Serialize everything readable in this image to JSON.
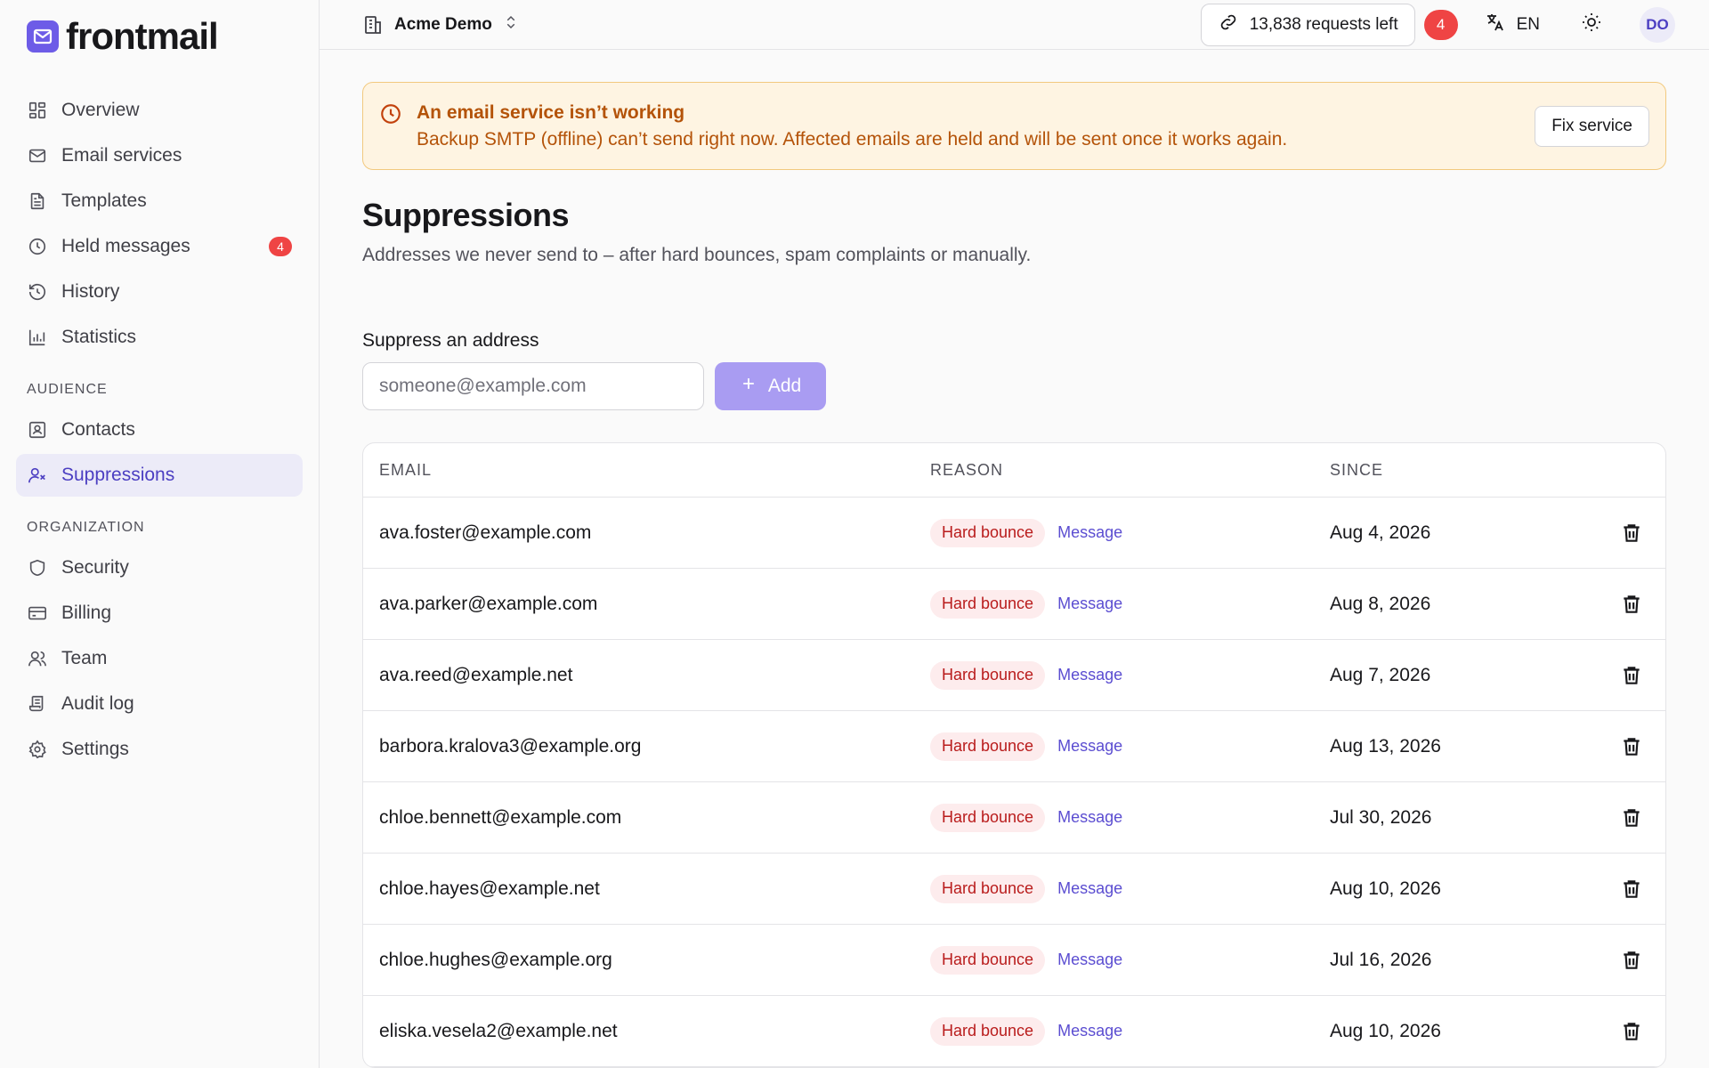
{
  "brand": {
    "name": "frontmail",
    "accent": "#6d5ce7"
  },
  "sidebar": {
    "items": [
      {
        "label": "Overview",
        "icon": "grid-icon"
      },
      {
        "label": "Email services",
        "icon": "mail-icon"
      },
      {
        "label": "Templates",
        "icon": "document-icon"
      },
      {
        "label": "Held messages",
        "icon": "clock-icon",
        "badge": "4"
      },
      {
        "label": "History",
        "icon": "history-icon"
      },
      {
        "label": "Statistics",
        "icon": "bar-chart-icon"
      }
    ],
    "audience_title": "AUDIENCE",
    "audience": [
      {
        "label": "Contacts",
        "icon": "contact-icon"
      },
      {
        "label": "Suppressions",
        "icon": "user-x-icon",
        "active": true
      }
    ],
    "organization_title": "ORGANIZATION",
    "organization": [
      {
        "label": "Security",
        "icon": "shield-icon"
      },
      {
        "label": "Billing",
        "icon": "credit-card-icon"
      },
      {
        "label": "Team",
        "icon": "users-icon"
      },
      {
        "label": "Audit log",
        "icon": "scroll-icon"
      },
      {
        "label": "Settings",
        "icon": "gear-icon"
      }
    ]
  },
  "topbar": {
    "org_name": "Acme Demo",
    "requests_left": "13,838 requests left",
    "notification_count": "4",
    "language": "EN",
    "avatar_initials": "DO"
  },
  "alert": {
    "title": "An email service isn’t working",
    "body": "Backup SMTP (offline) can’t send right now. Affected emails are held and will be sent once it works again.",
    "action": "Fix service",
    "color": "#b45309"
  },
  "page": {
    "title": "Suppressions",
    "subtitle": "Addresses we never send to – after hard bounces, spam complaints or manually."
  },
  "form": {
    "label": "Suppress an address",
    "placeholder": "someone@example.com",
    "add_label": "Add"
  },
  "table": {
    "headers": {
      "email": "EMAIL",
      "reason": "REASON",
      "since": "SINCE"
    },
    "rows": [
      {
        "email": "ava.foster@example.com",
        "reason": "Hard bounce",
        "link": "Message",
        "since": "Aug 4, 2026"
      },
      {
        "email": "ava.parker@example.com",
        "reason": "Hard bounce",
        "link": "Message",
        "since": "Aug 8, 2026"
      },
      {
        "email": "ava.reed@example.net",
        "reason": "Hard bounce",
        "link": "Message",
        "since": "Aug 7, 2026"
      },
      {
        "email": "barbora.kralova3@example.org",
        "reason": "Hard bounce",
        "link": "Message",
        "since": "Aug 13, 2026"
      },
      {
        "email": "chloe.bennett@example.com",
        "reason": "Hard bounce",
        "link": "Message",
        "since": "Jul 30, 2026"
      },
      {
        "email": "chloe.hayes@example.net",
        "reason": "Hard bounce",
        "link": "Message",
        "since": "Aug 10, 2026"
      },
      {
        "email": "chloe.hughes@example.org",
        "reason": "Hard bounce",
        "link": "Message",
        "since": "Jul 16, 2026"
      },
      {
        "email": "eliska.vesela2@example.net",
        "reason": "Hard bounce",
        "link": "Message",
        "since": "Aug 10, 2026"
      }
    ]
  }
}
